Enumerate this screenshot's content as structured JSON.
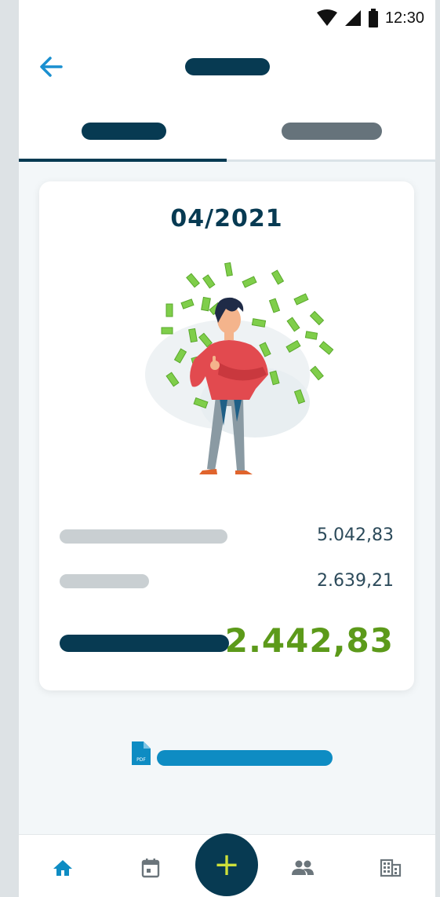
{
  "status_bar": {
    "time": "12:30",
    "icons": [
      "wifi-icon",
      "signal-icon",
      "battery-icon"
    ]
  },
  "app_bar": {
    "back_icon": "arrow-left-icon"
  },
  "tabs": [
    {
      "selected": true
    },
    {
      "selected": false
    }
  ],
  "card": {
    "period": "04/2021",
    "illustration": "man-with-money-illustration",
    "rows": [
      {
        "value": "5.042,83"
      },
      {
        "value": "2.639,21"
      }
    ],
    "total": "2.442,83"
  },
  "pdf": {
    "icon": "pdf-file-icon",
    "icon_label": "PDF"
  },
  "bottom_nav": {
    "items": [
      "home-icon",
      "calendar-icon",
      "add-icon",
      "people-icon",
      "building-icon"
    ],
    "fab_symbol": "+"
  },
  "colors": {
    "primary": "#073a52",
    "accent_blue": "#0e8cc3",
    "positive_green": "#5c9a1a",
    "fab_plus": "#cde03a"
  }
}
